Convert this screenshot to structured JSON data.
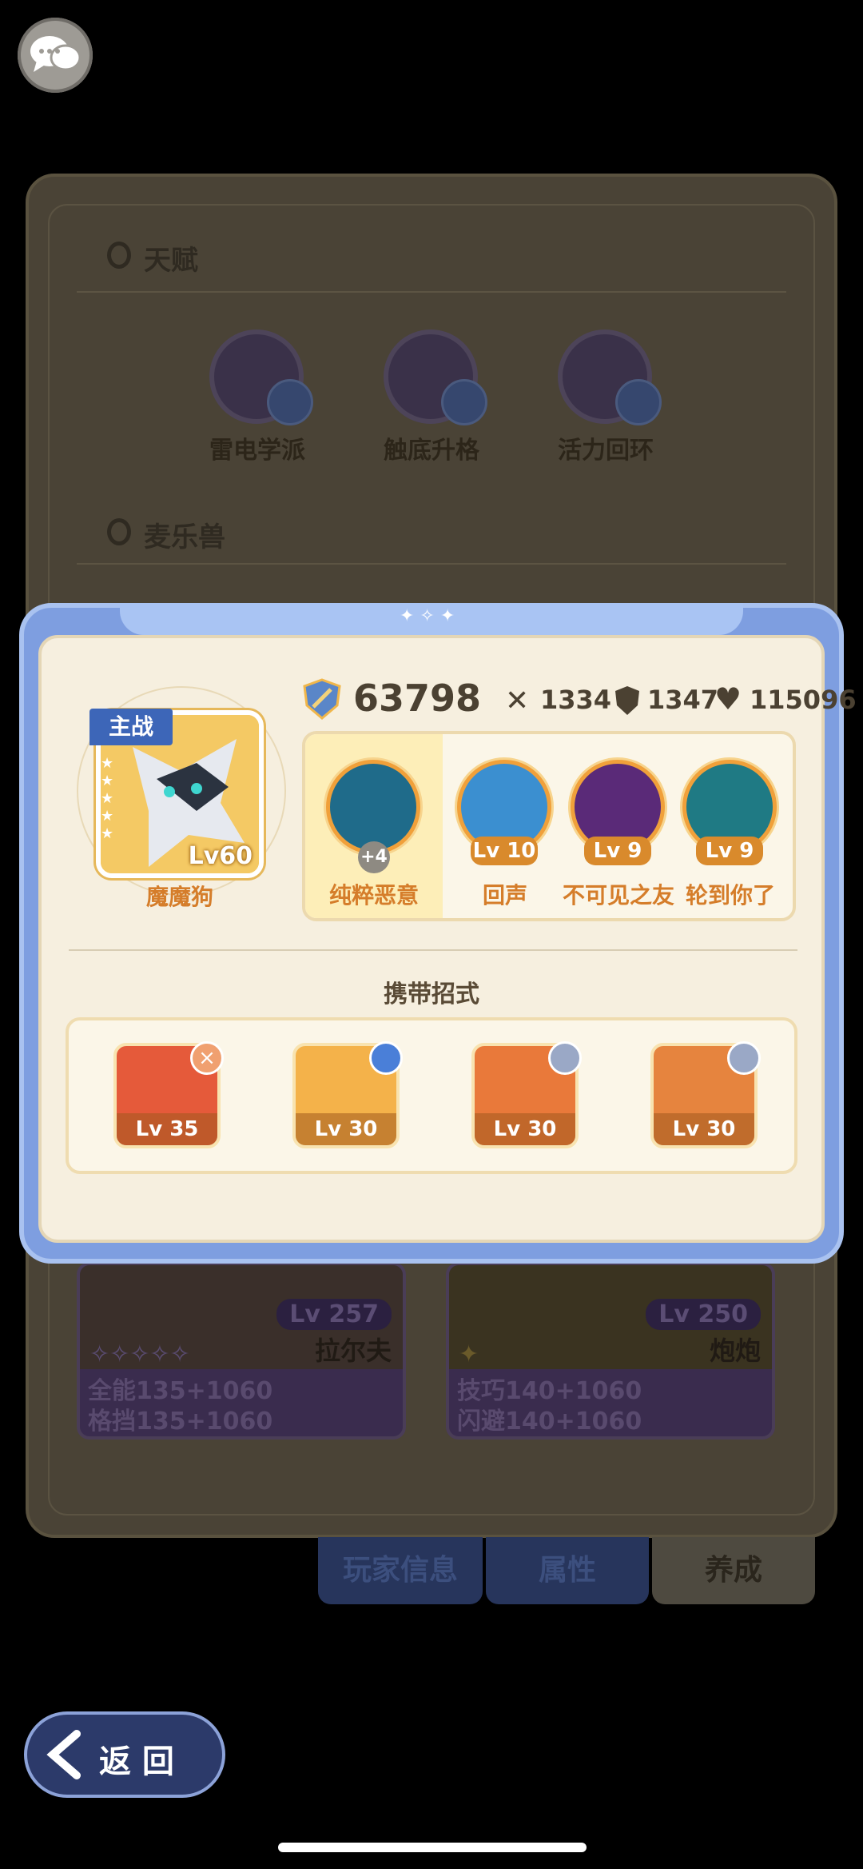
{
  "background": {
    "talent_section_title": "天赋",
    "talents": [
      {
        "label": "雷电学派",
        "icon": "lightning-icon"
      },
      {
        "label": "触底升格",
        "icon": "flower-icon"
      },
      {
        "label": "活力回环",
        "icon": "star-icon"
      }
    ],
    "beast_section_title": "麦乐兽",
    "beast_cards": [
      {
        "level": "Lv 257",
        "name": "拉尔夫",
        "stat1": "全能135+1060",
        "stat2": "格挡135+1060"
      },
      {
        "level": "Lv 250",
        "name": "炮炮",
        "stat1": "技巧140+1060",
        "stat2": "闪避140+1060"
      }
    ],
    "tabs": [
      {
        "label": "玩家信息",
        "active": false
      },
      {
        "label": "属性",
        "active": false
      },
      {
        "label": "养成",
        "active": true
      }
    ]
  },
  "modal": {
    "main_tag": "主战",
    "hero_level": "Lv60",
    "hero_name": "魔魔狗",
    "power": "63798",
    "attack": "1334",
    "defense": "1347",
    "hp": "115096",
    "team": [
      {
        "name": "纯粹恶意",
        "badge": "+4",
        "color": "#1f6b8a"
      },
      {
        "name": "回声",
        "badge": "Lv 10",
        "color": "#3b8fd0"
      },
      {
        "name": "不可见之友",
        "badge": "Lv 9",
        "color": "#5a2a78"
      },
      {
        "name": "轮到你了",
        "badge": "Lv 9",
        "color": "#1f7a84"
      }
    ],
    "skills_title": "携带招式",
    "skills": [
      {
        "level": "Lv 35",
        "badge_icon": "close-icon",
        "badge_color": "#f0a070"
      },
      {
        "level": "Lv 30",
        "badge_icon": "shield-icon",
        "badge_color": "#4a7fd8"
      },
      {
        "level": "Lv 30",
        "badge_icon": "swirl-icon",
        "badge_color": "#9aa8c6"
      },
      {
        "level": "Lv 30",
        "badge_icon": "swirl-icon",
        "badge_color": "#9aa8c6"
      }
    ]
  },
  "back_button": {
    "label": "返 回"
  },
  "colors": {
    "accent": "#7e9ee0",
    "cream": "#f6efdf",
    "orange": "#d57d2a"
  }
}
